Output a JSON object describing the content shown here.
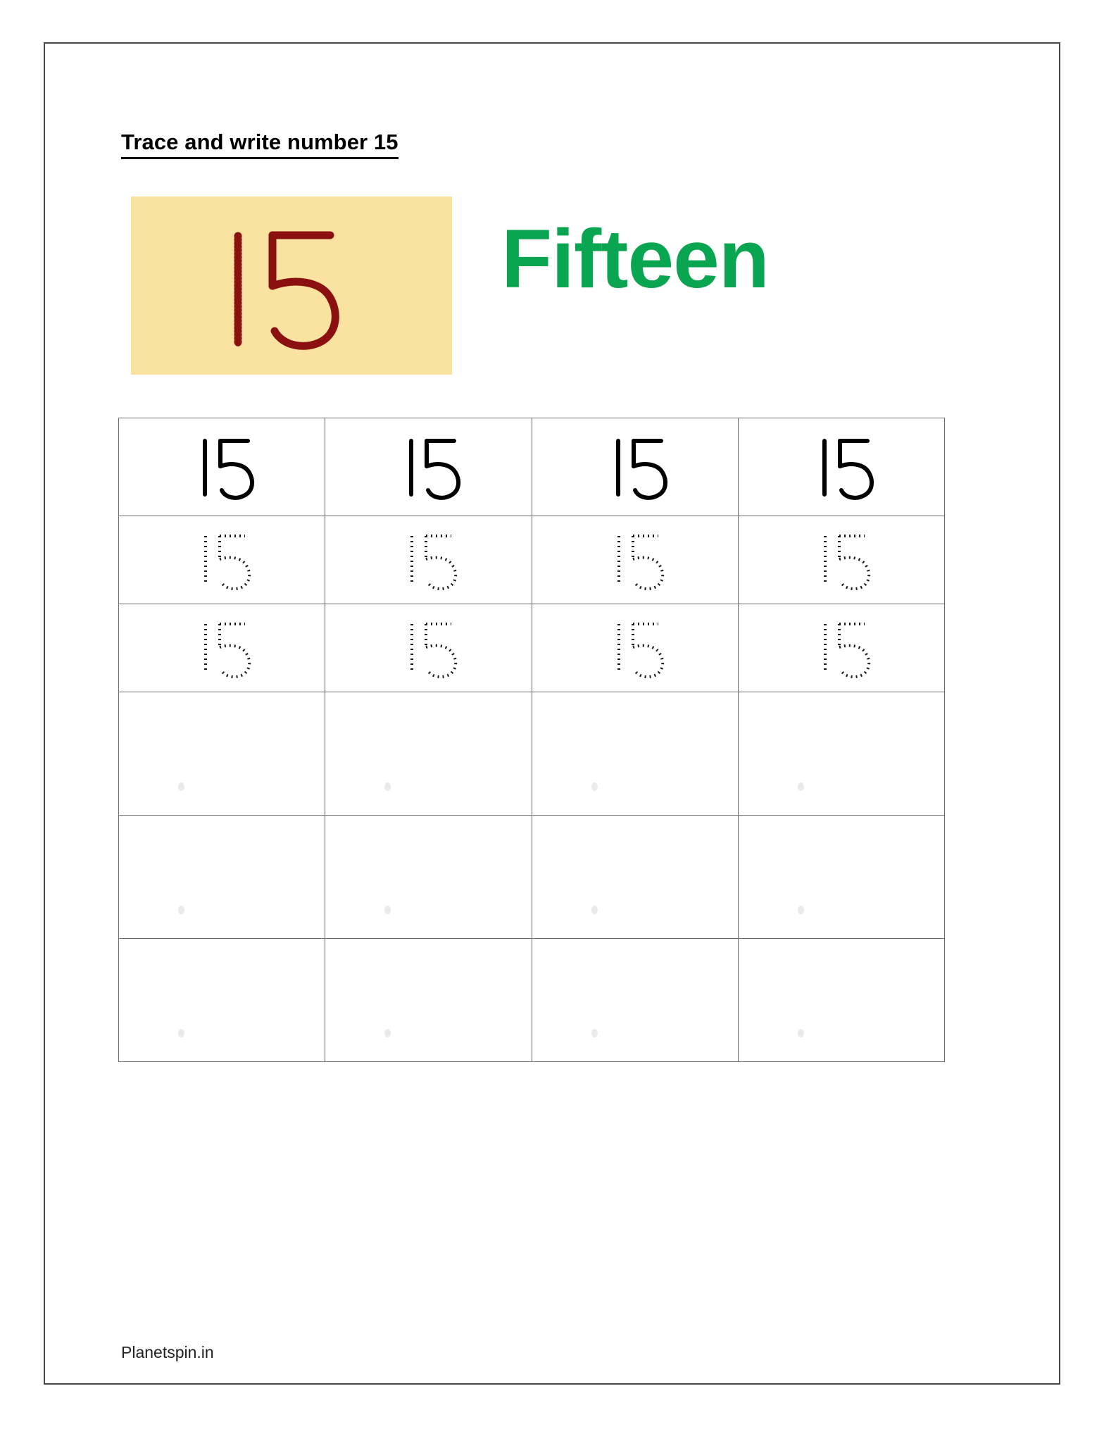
{
  "page": {
    "title": "Trace and write number 15",
    "footer": "Planetspin.in",
    "border_color": "#4a4a4a",
    "background": "#ffffff"
  },
  "hero": {
    "swatch_color": "#FAE3A1",
    "numeral": "15",
    "numeral_color": "#8B1111",
    "numeral_style": "dotted-trace",
    "word": "Fifteen",
    "word_color": "#0AA550"
  },
  "practice_grid": {
    "columns": 4,
    "rows": 6,
    "border_color": "#6b6b6b",
    "row_types": [
      "solid",
      "dotted",
      "dotted",
      "blank",
      "blank",
      "blank"
    ],
    "rows_data": [
      {
        "type": "solid",
        "cells": [
          "15",
          "15",
          "15",
          "15"
        ]
      },
      {
        "type": "dotted",
        "cells": [
          "15",
          "15",
          "15",
          "15"
        ]
      },
      {
        "type": "dotted",
        "cells": [
          "15",
          "15",
          "15",
          "15"
        ]
      },
      {
        "type": "blank",
        "cells": [
          "",
          "",
          "",
          ""
        ]
      },
      {
        "type": "blank",
        "cells": [
          "",
          "",
          "",
          ""
        ]
      },
      {
        "type": "blank",
        "cells": [
          "",
          "",
          "",
          ""
        ]
      }
    ],
    "solid_glyph_color": "#000000",
    "dotted_glyph_color": "#1a1a1a",
    "blank_marker_color": "#eaeaea"
  }
}
